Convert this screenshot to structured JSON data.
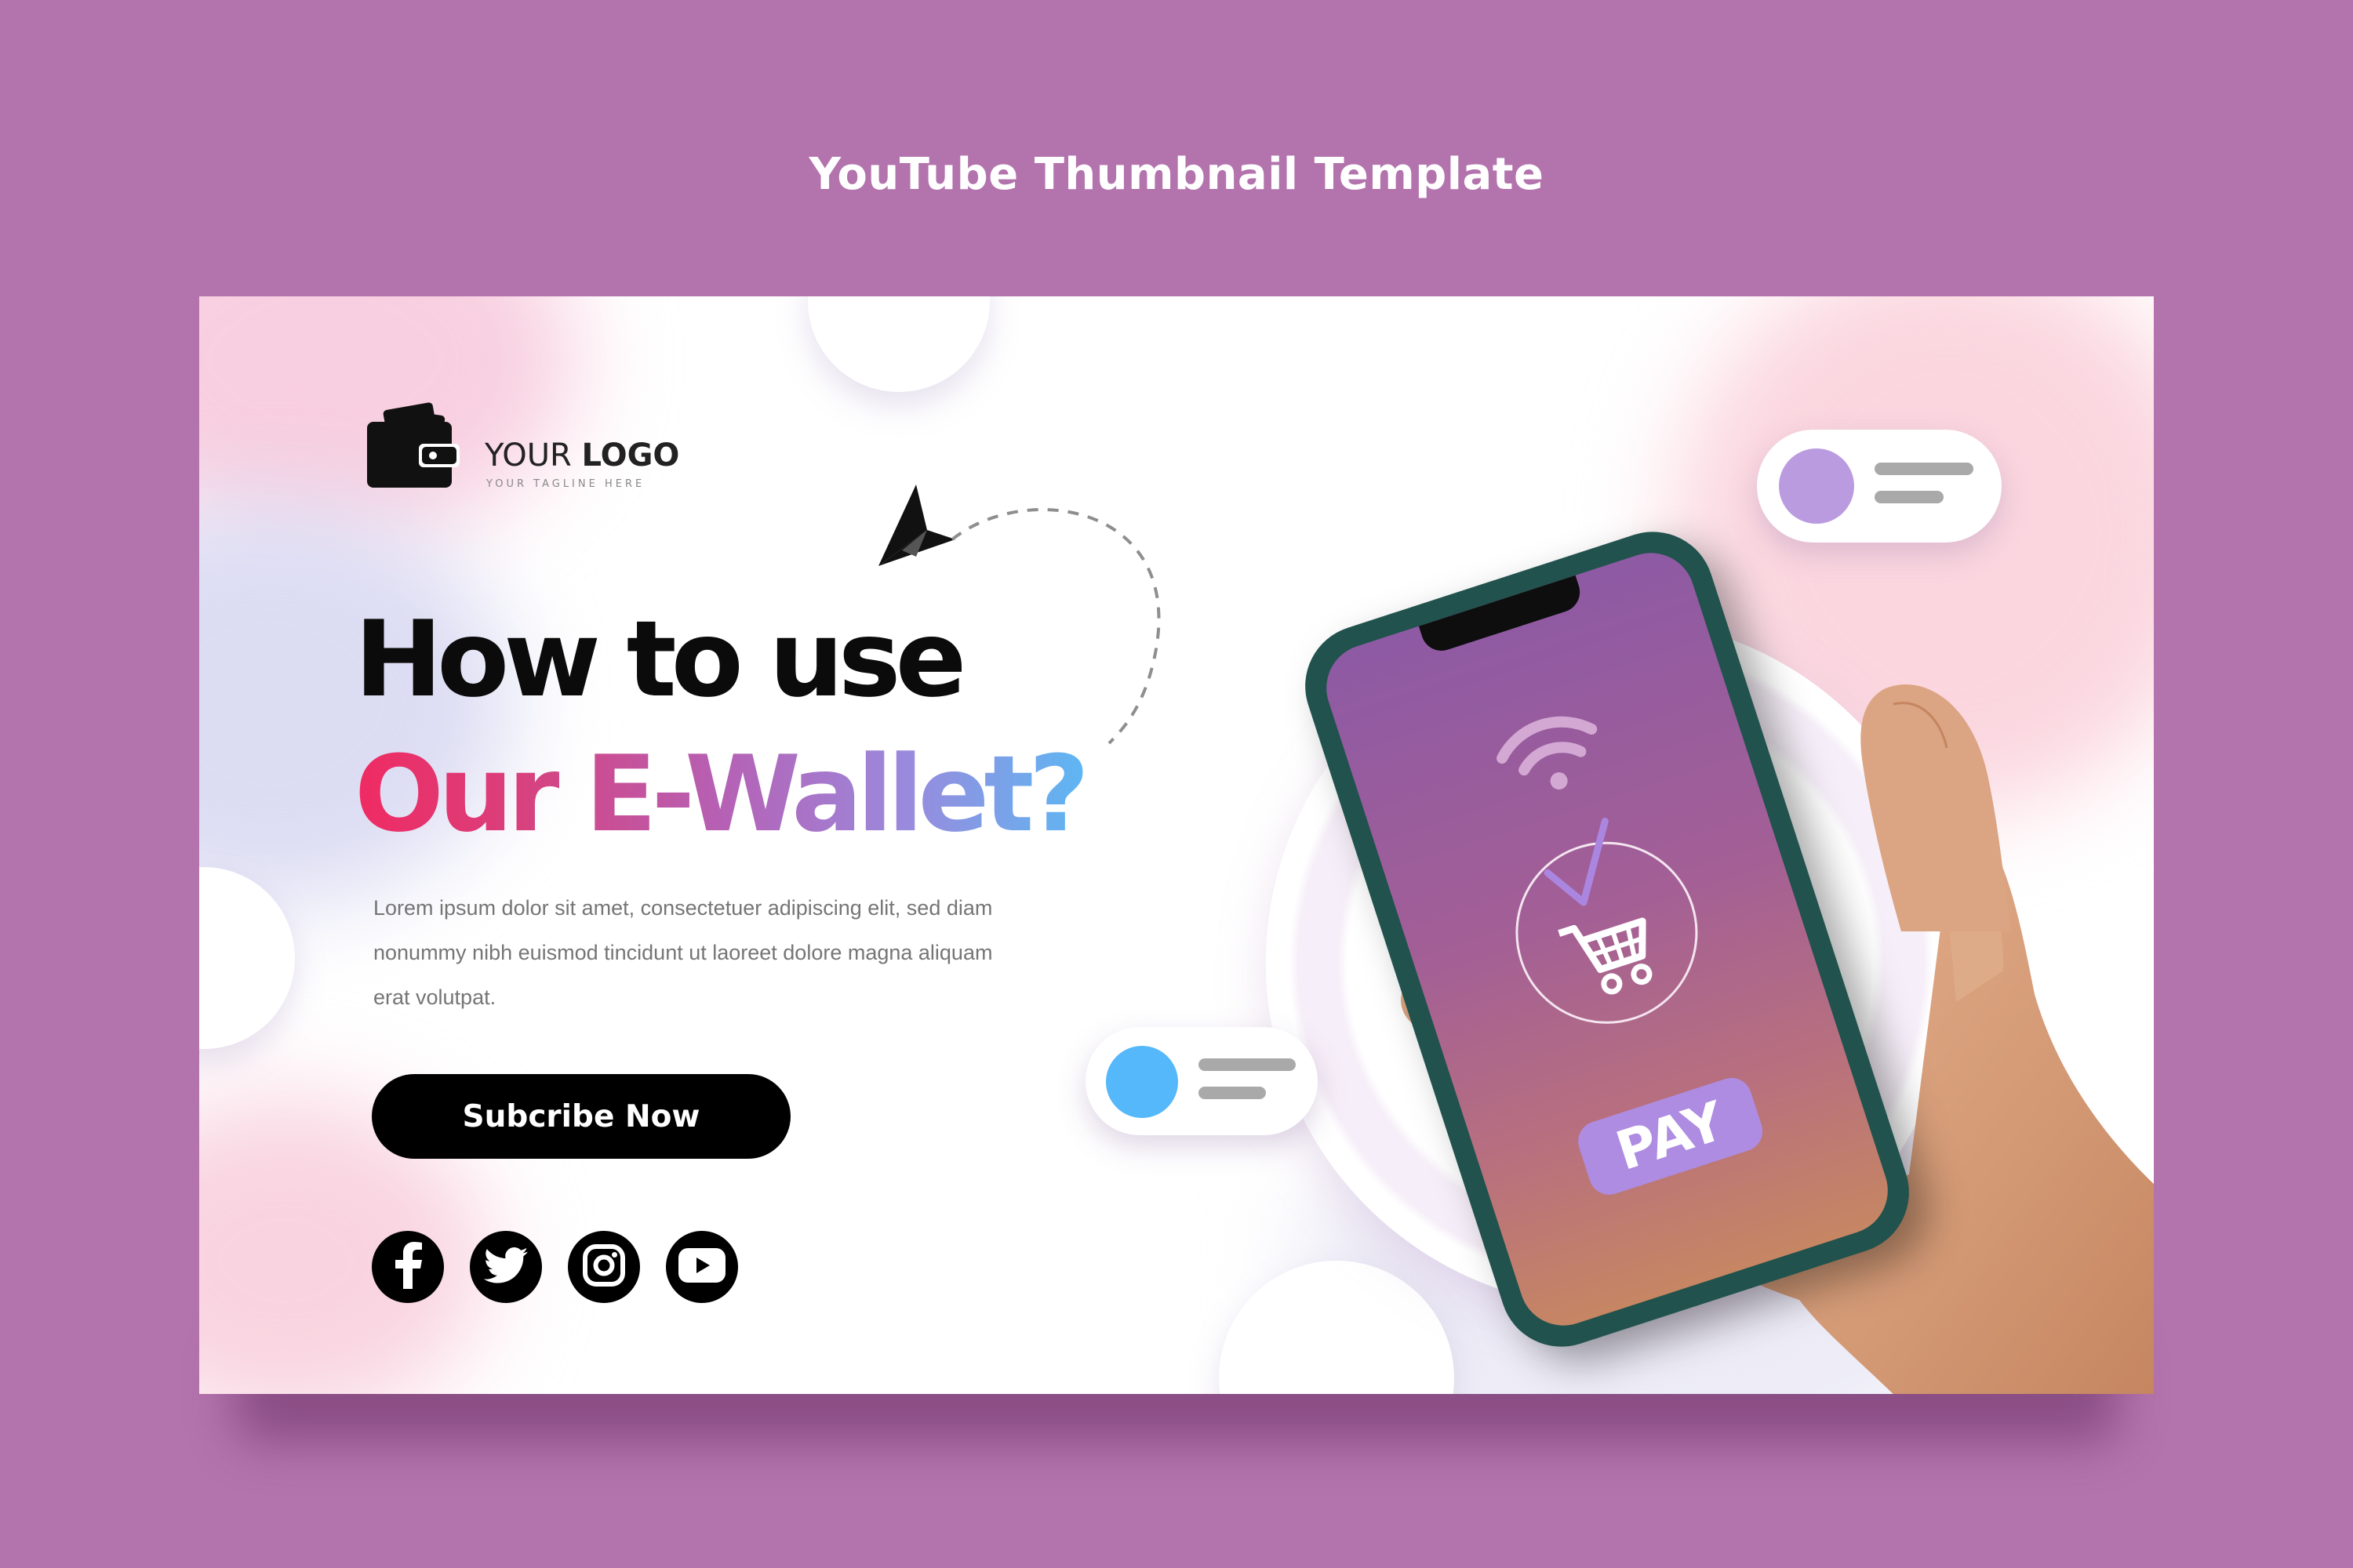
{
  "page": {
    "title": "YouTube Thumbnail Template",
    "background_color": "#b373ad"
  },
  "thumbnail": {
    "logo": {
      "icon": "wallet-icon",
      "text_regular": "YOUR",
      "text_bold": "LOGO",
      "tagline": "YOUR TAGLINE HERE"
    },
    "headline": {
      "line1": "How to use",
      "line2": "Our E-Wallet?",
      "gradient_colors": [
        "#f02a62",
        "#b660b4",
        "#9b89dc",
        "#5eb6f3"
      ]
    },
    "body_text": "Lorem ipsum dolor sit amet, consectetuer adipiscing elit, sed diam nonummy nibh euismod tincidunt ut laoreet dolore magna aliquam erat volutpat.",
    "cta": {
      "label": "Subcribe Now"
    },
    "social_icons": [
      "facebook-icon",
      "twitter-icon",
      "instagram-icon",
      "youtube-icon"
    ],
    "phone": {
      "screen_button": "PAY",
      "icons": [
        "wifi-icon",
        "checkmark-icon",
        "shopping-cart-icon"
      ]
    },
    "notifications": [
      {
        "dot_color": "#bb9be0"
      },
      {
        "dot_color": "#55b8fa"
      }
    ],
    "decoration": {
      "arrow_icon": "paper-plane-icon"
    }
  }
}
